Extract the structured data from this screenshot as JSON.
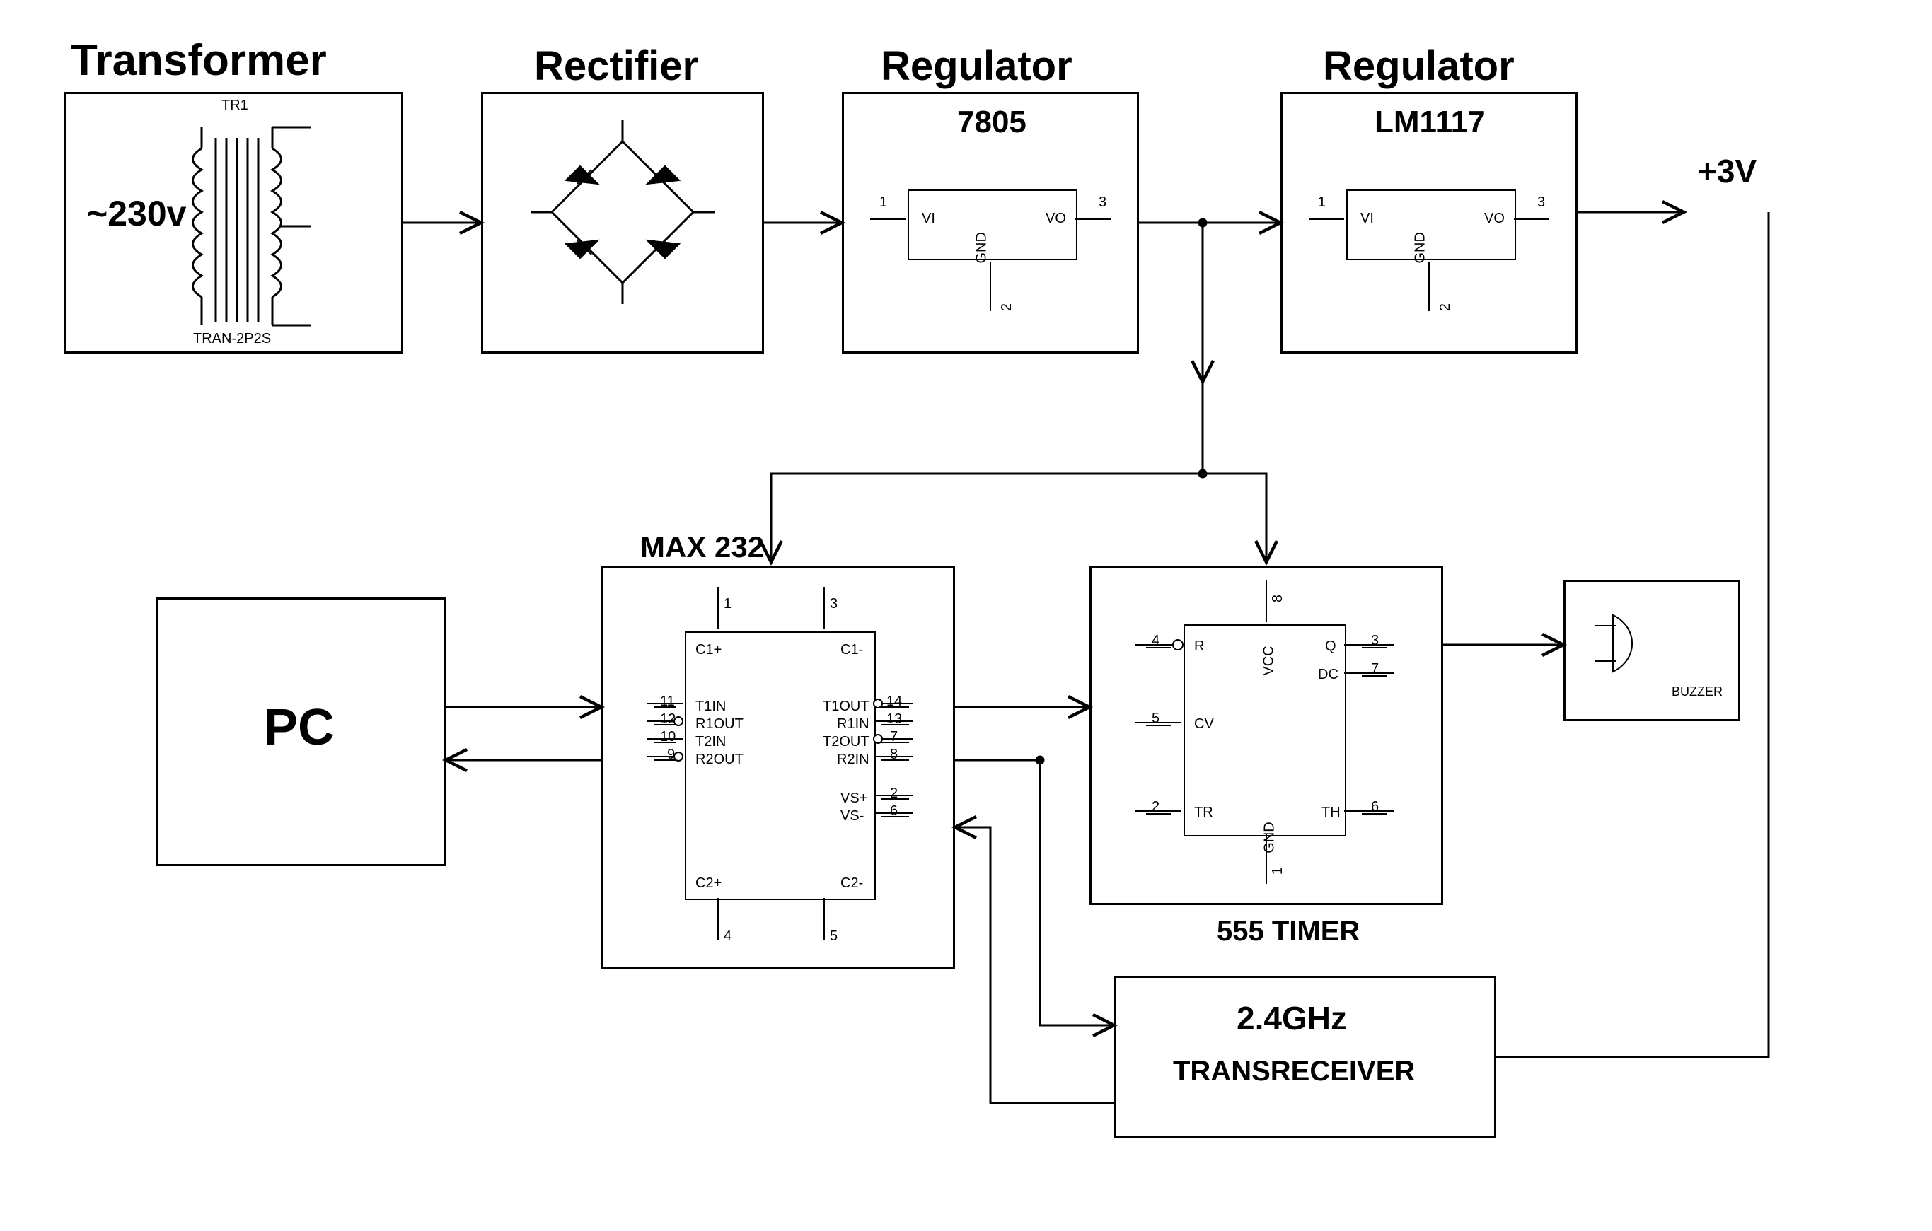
{
  "titles": {
    "transformer": "Transformer",
    "rectifier": "Rectifier",
    "regulator1": "Regulator",
    "regulator2": "Regulator",
    "pc": "PC",
    "max232": "MAX 232",
    "timer555": "555 TIMER",
    "ghz": "2.4GHz",
    "transreceiver": "TRANSRECEIVER",
    "buzzer": "BUZZER",
    "v3": "+3V"
  },
  "transformer": {
    "ref": "TR1",
    "voltage": "~230v",
    "part": "TRAN-2P2S"
  },
  "regulator7805": {
    "name": "7805",
    "vi": "VI",
    "vo": "VO",
    "gnd": "GND",
    "p1": "1",
    "p2": "2",
    "p3": "3"
  },
  "regulatorLM1117": {
    "name": "LM1117",
    "vi": "VI",
    "vo": "VO",
    "gnd": "GND",
    "p1": "1",
    "p2": "2",
    "p3": "3"
  },
  "max232": {
    "c1p": "C1+",
    "c1m": "C1-",
    "c2p": "C2+",
    "c2m": "C2-",
    "t1in": "T1IN",
    "r1out": "R1OUT",
    "t2in": "T2IN",
    "r2out": "R2OUT",
    "t1out": "T1OUT",
    "r1in": "R1IN",
    "t2out": "T2OUT",
    "r2in": "R2IN",
    "vsp": "VS+",
    "vsm": "VS-",
    "p1": "1",
    "p3": "3",
    "p4": "4",
    "p5": "5",
    "p11": "11",
    "p12": "12",
    "p10": "10",
    "p9": "9",
    "p14": "14",
    "p13": "13",
    "p7": "7",
    "p8": "8",
    "p2": "2",
    "p6": "6"
  },
  "timer": {
    "r": "R",
    "vcc": "VCC",
    "q": "Q",
    "dc": "DC",
    "cv": "CV",
    "tr": "TR",
    "gnd": "GND",
    "th": "TH",
    "p1": "1",
    "p2": "2",
    "p3": "3",
    "p4": "4",
    "p5": "5",
    "p6": "6",
    "p7": "7",
    "p8": "8"
  }
}
